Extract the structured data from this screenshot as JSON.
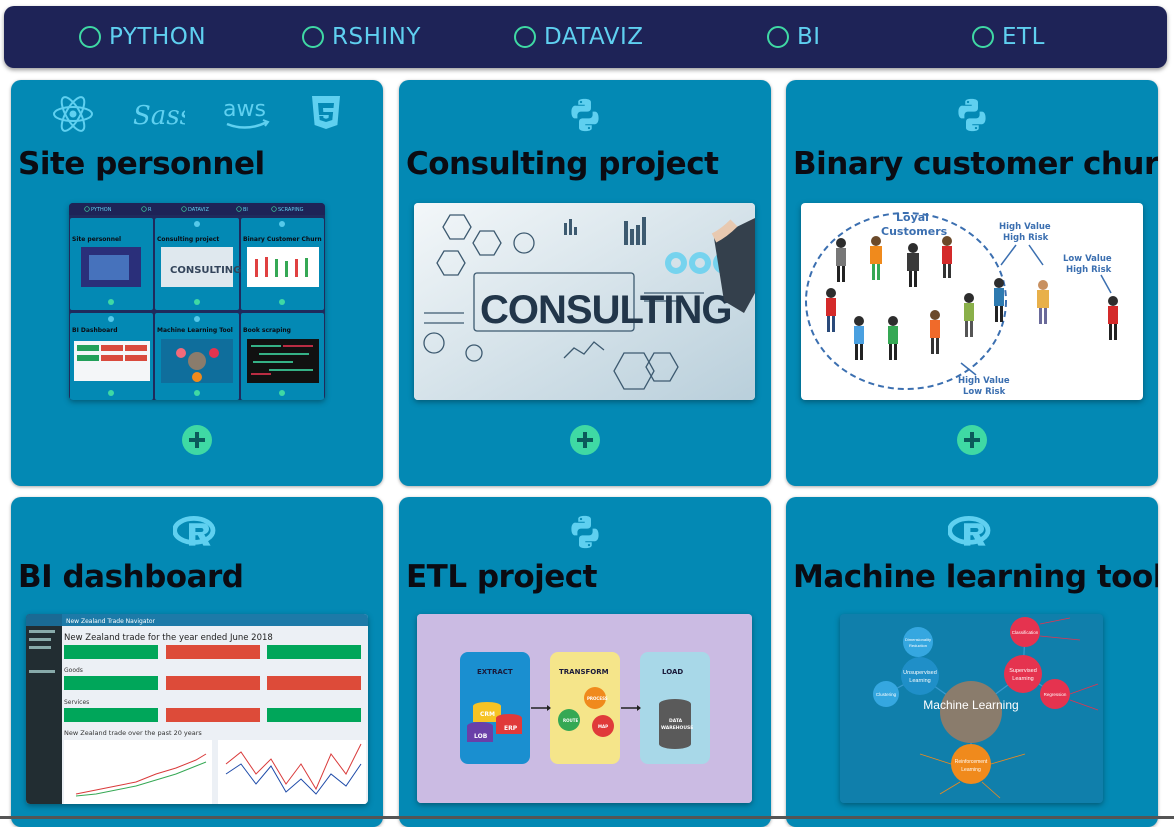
{
  "nav": {
    "items": [
      {
        "label": "PYTHON"
      },
      {
        "label": "RSHINY"
      },
      {
        "label": "DATAVIZ"
      },
      {
        "label": "BI"
      },
      {
        "label": "ETL"
      }
    ]
  },
  "colors": {
    "navbar_bg": "#1e2357",
    "nav_text": "#5fd0f0",
    "radio": "#3fd9a4",
    "card_bg": "#0389b4",
    "icon": "#5fd0f0",
    "plus": "#3fd9a4"
  },
  "cards": [
    {
      "title": "Site personnel",
      "icons": [
        "react-icon",
        "sass-icon",
        "aws-icon",
        "css3-icon"
      ],
      "aws_text": "aws",
      "thumb": {
        "nav": [
          "PYTHON",
          "R",
          "DATAVIZ",
          "BI",
          "SCRAPING"
        ],
        "tiles": [
          "Site personnel",
          "Consulting project",
          "Binary Customer Churn",
          "BI Dashboard",
          "Machine Learning Tool",
          "Book scraping"
        ],
        "consulting_word": "CONSULTING"
      }
    },
    {
      "title": "Consulting project",
      "icons": [
        "python-icon"
      ],
      "thumb": {
        "word": "CONSULTING"
      }
    },
    {
      "title": "Binary customer churn",
      "icons": [
        "python-icon"
      ],
      "thumb": {
        "loyal": "Loyal Customers",
        "hv_hr": "High Value High Risk",
        "lv_hr": "Low Value High Risk",
        "hv_lr": "High Value Low Risk"
      }
    },
    {
      "title": "BI dashboard",
      "icons": [
        "r-icon"
      ],
      "thumb": {
        "header": "New Zealand Trade Navigator",
        "heading": "New Zealand trade for the year ended June 2018",
        "goods": "Goods",
        "services": "Services",
        "history": "New Zealand trade over the past 20 years"
      }
    },
    {
      "title": "ETL project",
      "icons": [
        "python-icon"
      ],
      "thumb": {
        "extract": "EXTRACT",
        "transform": "TRANSFORM",
        "load": "LOAD",
        "crm": "CRM",
        "lob": "LOB",
        "erp": "ERP",
        "warehouse": "DATA WAREHOUSE",
        "process": "PROCESS",
        "route": "ROUTE",
        "map": "MAP"
      }
    },
    {
      "title": "Machine learning tool",
      "icons": [
        "r-icon"
      ],
      "thumb": {
        "center": "Machine Learning",
        "unsupervised": "Unsupervised Learning",
        "supervised": "Supervised Learning",
        "reinforcement": "Reinforcement Learning",
        "classification": "Classification",
        "regression": "Regression",
        "clustering": "Clustering",
        "dimensionality": "Dimensionality Reduction"
      }
    }
  ]
}
